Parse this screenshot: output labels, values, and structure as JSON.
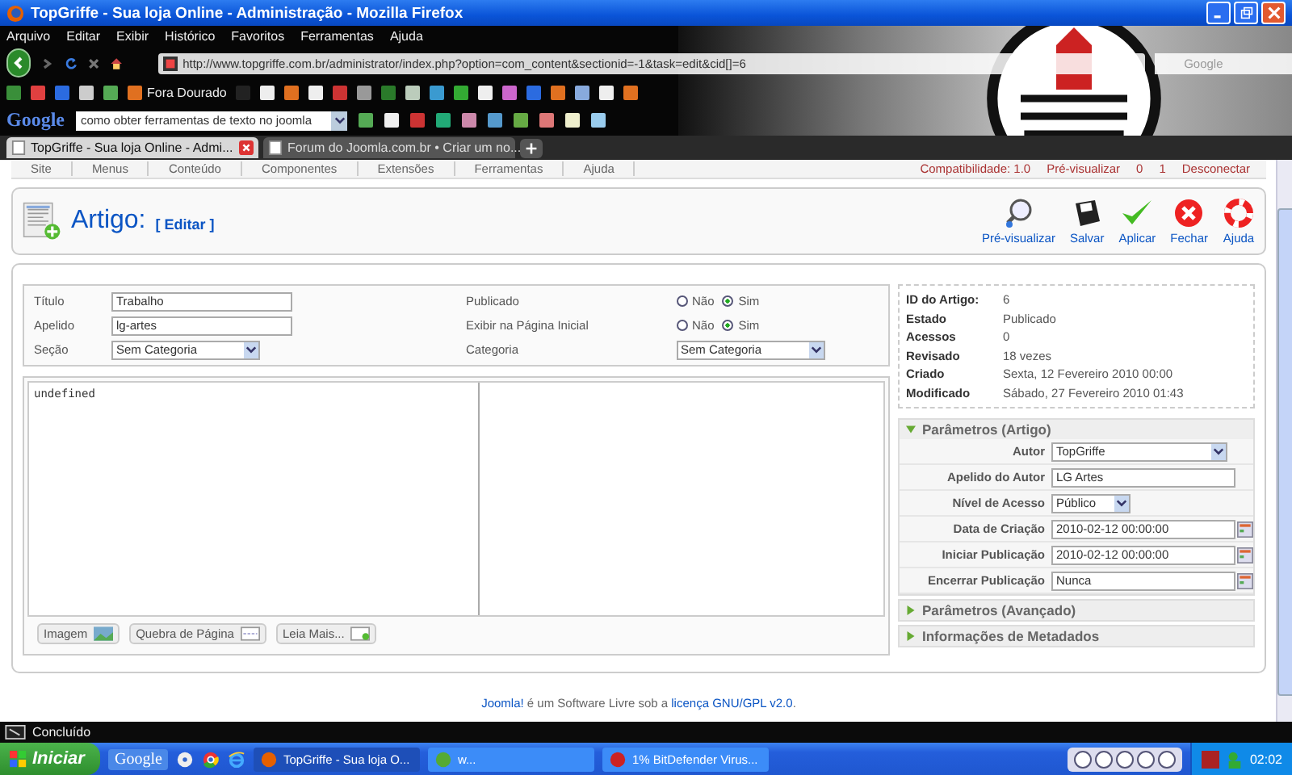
{
  "window": {
    "title": "TopGriffe - Sua loja Online - Administração - Mozilla Firefox"
  },
  "menu": [
    "Arquivo",
    "Editar",
    "Exibir",
    "Histórico",
    "Favoritos",
    "Ferramentas",
    "Ajuda"
  ],
  "address": {
    "value": "http://www.topgriffe.com.br/administrator/index.php?option=com_content&sectionid=-1&task=edit&cid[]=6"
  },
  "web_search": {
    "placeholder": "Google"
  },
  "bookmarks": [
    {
      "label": "Fora Dourado"
    }
  ],
  "google_toolbar": {
    "logo": "Google",
    "value": "como obter ferramentas de texto no joomla"
  },
  "tabs": [
    {
      "label": "TopGriffe - Sua loja Online - Admi...",
      "selected": true
    },
    {
      "label": "Forum do Joomla.com.br • Criar um no...",
      "selected": false
    }
  ],
  "admin_menu": [
    "Site",
    "Menus",
    "Conteúdo",
    "Componentes",
    "Extensões",
    "Ferramentas",
    "Ajuda"
  ],
  "admin_status": [
    "Compatibilidade: 1.0",
    "Pré-visualizar",
    "0",
    "1",
    "Desconectar"
  ],
  "page": {
    "title": "Artigo:",
    "subtitle": "[ Editar ]"
  },
  "toolbar": [
    {
      "kind": "preview",
      "label": "Pré-visualizar"
    },
    {
      "kind": "save",
      "label": "Salvar"
    },
    {
      "kind": "apply",
      "label": "Aplicar"
    },
    {
      "kind": "close",
      "label": "Fechar"
    },
    {
      "kind": "help",
      "label": "Ajuda"
    }
  ],
  "form_left": [
    {
      "kind": "text",
      "label": "Título",
      "value": "Trabalho"
    },
    {
      "kind": "text",
      "label": "Apelido",
      "value": "lg-artes"
    },
    {
      "kind": "select",
      "label": "Seção",
      "value": "Sem Categoria"
    }
  ],
  "form_right": [
    {
      "kind": "radio",
      "label": "Publicado",
      "options": [
        {
          "label": "Não",
          "selected": false
        },
        {
          "label": "Sim",
          "selected": true
        }
      ]
    },
    {
      "kind": "radio",
      "label": "Exibir na Página Inicial",
      "options": [
        {
          "label": "Não",
          "selected": false
        },
        {
          "label": "Sim",
          "selected": true
        }
      ]
    },
    {
      "kind": "select",
      "label": "Categoria",
      "value": "Sem Categoria"
    }
  ],
  "editor": {
    "value": "undefined",
    "buttons": [
      {
        "kind": "image",
        "label": "Imagem"
      },
      {
        "kind": "pagebreak",
        "label": "Quebra de Página"
      },
      {
        "kind": "readmore",
        "label": "Leia Mais..."
      }
    ]
  },
  "info": [
    {
      "label": "ID do Artigo:",
      "value": "6"
    },
    {
      "label": "Estado",
      "value": "Publicado"
    },
    {
      "label": "Acessos",
      "value": "0"
    },
    {
      "label": "Revisado",
      "value": "18 vezes"
    },
    {
      "label": "Criado",
      "value": "Sexta, 12 Fevereiro 2010 00:00"
    },
    {
      "label": "Modificado",
      "value": "Sábado, 27 Fevereiro 2010 01:43"
    }
  ],
  "panels": [
    {
      "title": "Parâmetros (Artigo)",
      "expanded": true,
      "fields": [
        {
          "kind": "select",
          "label": "Autor",
          "value": "TopGriffe"
        },
        {
          "kind": "text",
          "label": "Apelido do Autor",
          "value": "LG Artes"
        },
        {
          "kind": "select",
          "label": "Nível de Acesso",
          "value": "Público"
        },
        {
          "kind": "date",
          "label": "Data de Criação",
          "value": "2010-02-12 00:00:00"
        },
        {
          "kind": "date",
          "label": "Iniciar Publicação",
          "value": "2010-02-12 00:00:00"
        },
        {
          "kind": "date",
          "label": "Encerrar Publicação",
          "value": "Nunca"
        }
      ]
    },
    {
      "title": "Parâmetros (Avançado)",
      "expanded": false
    },
    {
      "title": "Informações de Metadados",
      "expanded": false
    }
  ],
  "footer": [
    {
      "text": "Joomla!",
      "link": true
    },
    {
      "text": " é um Software Livre sob a ",
      "link": false
    },
    {
      "text": "licença GNU/GPL v2.0",
      "link": true
    },
    {
      "text": ".",
      "link": false
    }
  ],
  "status_bar": {
    "text": "Concluído"
  },
  "taskbar": {
    "start": "Iniciar",
    "quick_launch": "Google",
    "tasks": [
      {
        "label": "TopGriffe - Sua loja O...",
        "selected": true
      },
      {
        "label": "w...",
        "selected": false
      },
      {
        "label": "1% BitDefender Virus...",
        "selected": false
      }
    ],
    "clock": "02:02"
  }
}
